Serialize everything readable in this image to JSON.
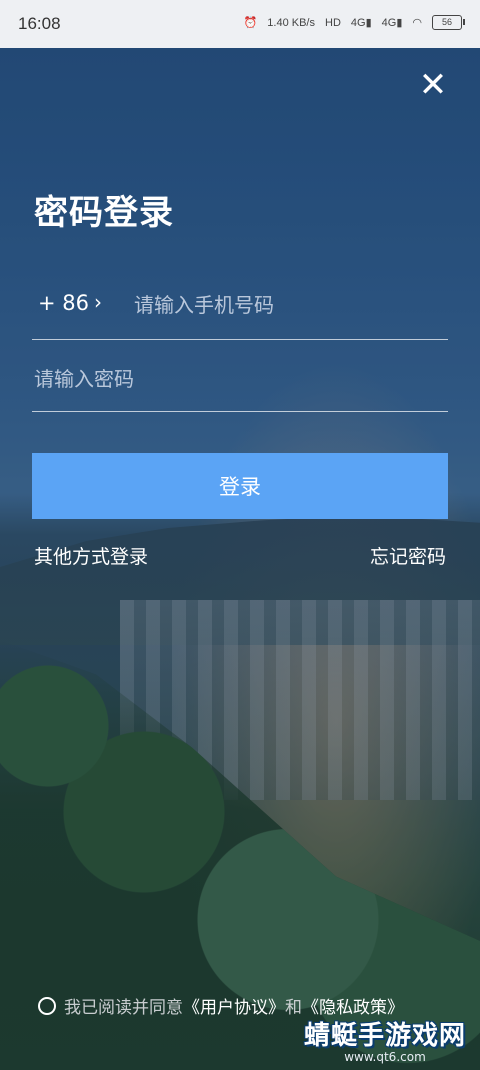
{
  "status_bar": {
    "time": "16:08",
    "network_speed": "1.40 KB/s",
    "sim1": "4G",
    "sim2": "4G",
    "battery": "56"
  },
  "header": {
    "close_icon": "close-icon"
  },
  "title": "密码登录",
  "phone": {
    "country_code": "+ 86",
    "chevron": "›",
    "placeholder": "请输入手机号码"
  },
  "password": {
    "placeholder": "请输入密码"
  },
  "login_button": "登录",
  "links": {
    "other_login": "其他方式登录",
    "forgot_password": "忘记密码"
  },
  "agreement": {
    "prefix": "我已阅读并同意",
    "user_agreement": "《用户协议》",
    "and": "和",
    "privacy_policy": "《隐私政策》"
  },
  "watermark": {
    "main": "蜻蜓手游戏网",
    "sub": "www.qt6.com"
  },
  "colors": {
    "accent": "#5ba4f5",
    "text": "#ffffff"
  }
}
